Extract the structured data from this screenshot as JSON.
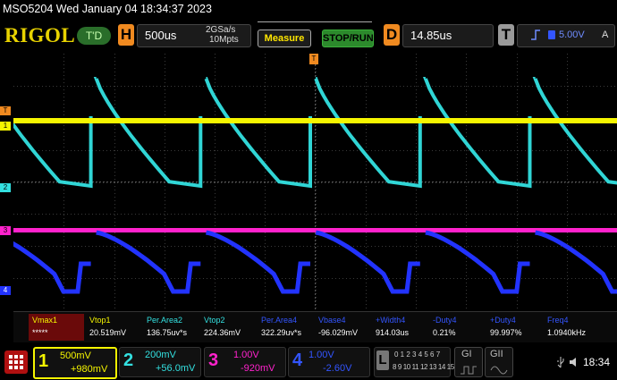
{
  "window": {
    "title": "MSO5204  Wed January 04 18:34:37 2023"
  },
  "header": {
    "logo": "RIGOL",
    "trigger_status": "T'D",
    "horizontal": {
      "letter": "H",
      "timebase": "500us",
      "sample_rate": "2GSa/s",
      "memory": "10Mpts"
    },
    "measure_label": "Measure",
    "run_stop_label": "STOP/RUN",
    "delay": {
      "letter": "D",
      "value": "14.85us"
    },
    "trigger": {
      "letter": "T",
      "level": "5.00V",
      "mode": "A"
    }
  },
  "waveform": {
    "colors": {
      "ch1": "#f5f500",
      "ch2": "#33e0e0",
      "ch3": "#ff22cc",
      "ch4": "#2233ff",
      "grid": "#3a3a3a"
    },
    "markers": {
      "trigger_pos": "T",
      "ch1_trigger": "T",
      "ch1": "1",
      "ch2": "2",
      "ch3": "3",
      "ch4": "4"
    }
  },
  "measurements": [
    {
      "label": "Vmax1",
      "value": "*****",
      "color": "#f5f500",
      "highlight": true
    },
    {
      "label": "Vtop1",
      "value": "20.519mV",
      "color": "#f5f500"
    },
    {
      "label": "Per.Area2",
      "value": "136.75uv*s",
      "color": "#33e0e0"
    },
    {
      "label": "Vtop2",
      "value": "224.36mV",
      "color": "#33e0e0"
    },
    {
      "label": "Per.Area4",
      "value": "322.29uv*s",
      "color": "#3355ff"
    },
    {
      "label": "Vbase4",
      "value": "-96.029mV",
      "color": "#3355ff"
    },
    {
      "label": "+Width4",
      "value": "914.03us",
      "color": "#3355ff"
    },
    {
      "label": "-Duty4",
      "value": "0.21%",
      "color": "#3355ff"
    },
    {
      "label": "+Duty4",
      "value": "99.997%",
      "color": "#3355ff"
    },
    {
      "label": "Freq4",
      "value": "1.0940kHz",
      "color": "#3355ff"
    }
  ],
  "channels": [
    {
      "num": "1",
      "scale": "500mV",
      "offset": "+980mV",
      "color": "#f5f500"
    },
    {
      "num": "2",
      "scale": "200mV",
      "offset": "+56.0mV",
      "color": "#33e0e0"
    },
    {
      "num": "3",
      "scale": "1.00V",
      "offset": "-920mV",
      "color": "#ff22cc"
    },
    {
      "num": "4",
      "scale": "1.00V",
      "offset": "-2.60V",
      "color": "#2233ff"
    }
  ],
  "logic": {
    "letter": "L",
    "digits_row1": "0 1 2 3 4 5 6 7",
    "digits_row2": "8 9 10 11 12 13 14 15"
  },
  "generators": {
    "g1": "GI",
    "g2": "GII"
  },
  "status": {
    "time": "18:34"
  }
}
